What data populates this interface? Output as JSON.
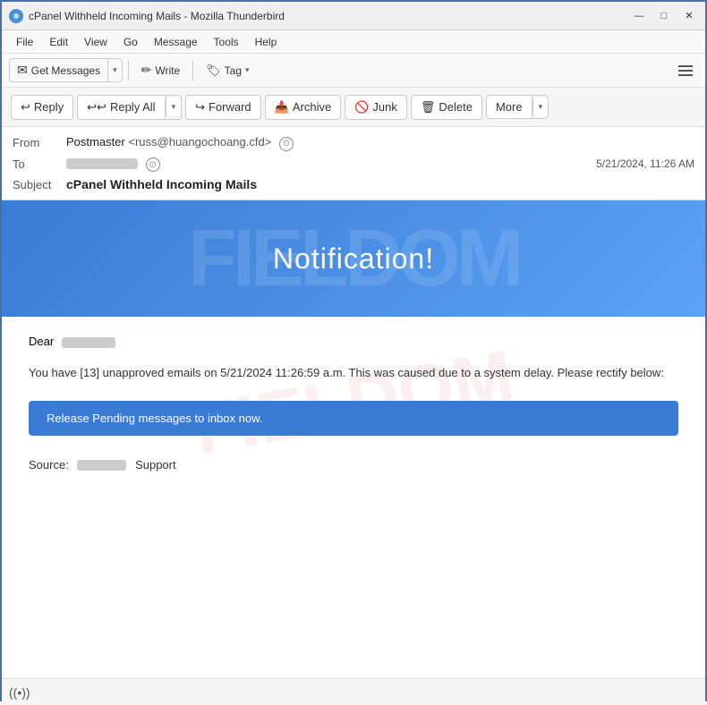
{
  "window": {
    "title": "cPanel Withheld Incoming Mails - Mozilla Thunderbird",
    "icon": "⊕",
    "controls": {
      "minimize": "—",
      "maximize": "□",
      "close": "✕"
    }
  },
  "menubar": {
    "items": [
      "File",
      "Edit",
      "View",
      "Go",
      "Message",
      "Tools",
      "Help"
    ]
  },
  "toolbar": {
    "get_messages": "Get Messages",
    "write": "Write",
    "tag": "Tag",
    "hamburger_label": "menu"
  },
  "actionbar": {
    "reply": "Reply",
    "reply_all": "Reply All",
    "forward": "Forward",
    "archive": "Archive",
    "junk": "Junk",
    "delete": "Delete",
    "more": "More"
  },
  "email": {
    "from_label": "From",
    "from_name": "Postmaster",
    "from_email": "<russ@huangochoang.cfd>",
    "to_label": "To",
    "to_value": "██████████",
    "date": "5/21/2024, 11:26 AM",
    "subject_label": "Subject",
    "subject": "cPanel Withheld Incoming Mails"
  },
  "body": {
    "banner_text": "Notification!",
    "watermark_banner": "FIELDOM",
    "dear_prefix": "Dear",
    "dear_name": "██████",
    "body_text": "You have [13] unapproved emails on 5/21/2024 11:26:59 a.m. This was caused due to a system delay. Please rectify below:",
    "cta_text": "Release Pending messages to inbox now.",
    "source_label": "Source:",
    "source_name": "███████",
    "source_suffix": "Support",
    "watermark_content": "FIELDOM"
  },
  "statusbar": {
    "icon": "((•))",
    "text": ""
  },
  "colors": {
    "accent": "#3a7bd5",
    "border": "#4a6fa5",
    "banner_bg": "#3a7bd5"
  }
}
